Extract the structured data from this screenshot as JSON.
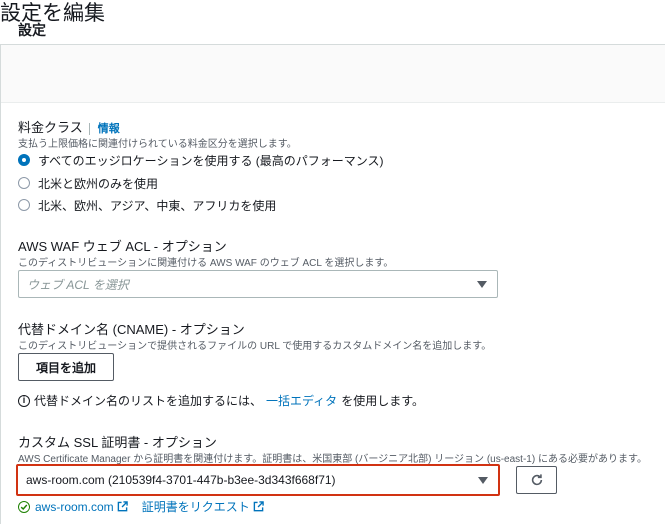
{
  "page": {
    "title": "設定を編集"
  },
  "panel": {
    "title": "設定"
  },
  "price_class": {
    "label": "料金クラス",
    "info": "情報",
    "description": "支払う上限価格に関連付けられている料金区分を選択します。",
    "options": [
      {
        "label": "すべてのエッジロケーションを使用する (最高のパフォーマンス)",
        "selected": true
      },
      {
        "label": "北米と欧州のみを使用",
        "selected": false
      },
      {
        "label": "北米、欧州、アジア、中東、アフリカを使用",
        "selected": false
      }
    ]
  },
  "waf": {
    "label": "AWS WAF ウェブ ACL - オプション",
    "description": "このディストリビューションに関連付ける AWS WAF のウェブ ACL を選択します。",
    "placeholder": "ウェブ ACL を選択"
  },
  "cname": {
    "label": "代替ドメイン名 (CNAME) - オプション",
    "description": "このディストリビューションで提供されるファイルの URL で使用するカスタムドメイン名を追加します。",
    "add_button": "項目を追加",
    "note_prefix": "代替ドメイン名のリストを追加するには、",
    "note_link": "一括エディタ",
    "note_suffix": "を使用します。"
  },
  "ssl": {
    "label": "カスタム SSL 証明書 - オプション",
    "description": "AWS Certificate Manager から証明書を関連付けます。証明書は、米国東部 (バージニア北部) リージョン (us-east-1) にある必要があります。",
    "selected_value": "aws-room.com (210539f4-3701-447b-b3ee-3d343f668f71)",
    "cert_link": "aws-room.com",
    "request_link": "証明書をリクエスト"
  },
  "colors": {
    "link": "#0073bb",
    "error_border": "#d13212",
    "success": "#1d8102"
  }
}
